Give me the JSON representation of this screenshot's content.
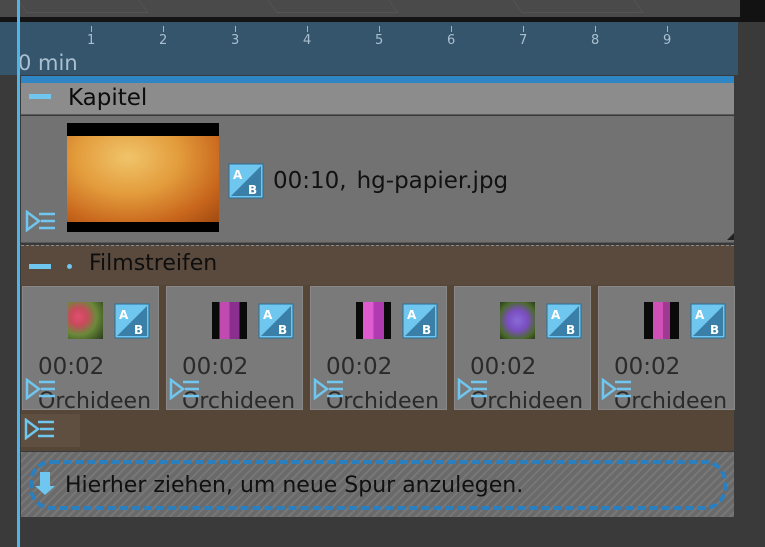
{
  "ruler": {
    "ticks": [
      "1",
      "2",
      "3",
      "4",
      "5",
      "6",
      "7",
      "8",
      "9"
    ],
    "unit_label": "0 min"
  },
  "chapter": {
    "title": "Kapitel",
    "item": {
      "duration": "00:10,",
      "filename": "hg-papier.jpg"
    }
  },
  "filmstrip": {
    "title": "Filmstreifen",
    "clips": [
      {
        "duration": "00:02",
        "name": "Orchideen"
      },
      {
        "duration": "00:02",
        "name": "Orchideen"
      },
      {
        "duration": "00:02",
        "name": "Orchideen"
      },
      {
        "duration": "00:02",
        "name": "Orchideen"
      },
      {
        "duration": "00:02",
        "name": "Orchideen"
      }
    ]
  },
  "dropzone": {
    "text": "Hierher ziehen, um neue Spur anzulegen."
  },
  "icons": {
    "transition": "transition-ab-icon",
    "placeholder": "placeholder-track-icon",
    "collapse": "collapse-minus-icon",
    "drop": "drop-arrow-down-icon"
  },
  "colors": {
    "accent": "#4fb4e8",
    "chapter_header": "#8c8c8c",
    "filmstrip_bg": "#564638",
    "ruler_bg": "#35556d"
  }
}
